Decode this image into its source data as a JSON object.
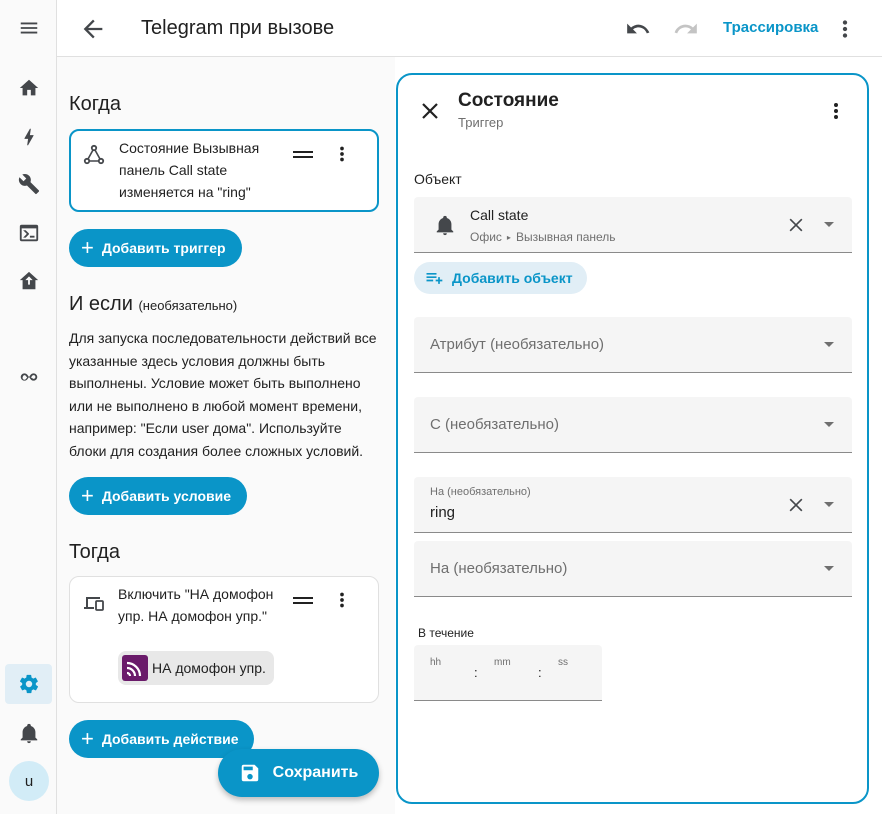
{
  "topbar": {
    "title": "Telegram при вызове",
    "trace_label": "Трассировка"
  },
  "sidebar": {
    "avatar_initial": "u",
    "items": [
      "home-icon",
      "lightning-icon",
      "wrench-icon",
      "terminal-icon",
      "ha-upload-icon",
      "integration-icon",
      "gear-icon",
      "bell-icon"
    ]
  },
  "when": {
    "heading": "Когда",
    "trigger_text": "Состояние Вызывная панель Call state изменяется на \"ring\"",
    "add_button": "Добавить триггер"
  },
  "and_if": {
    "heading": "И если",
    "heading_optional": "(необязательно)",
    "description": "Для запуска последовательности действий все указанные здесь условия должны быть выполнены. Условие может быть выполнено или не выполнено в любой момент времени, например: \"Если user дома\". Используйте блоки для создания более сложных условий.",
    "add_button": "Добавить условие"
  },
  "then": {
    "heading": "Тогда",
    "action_text": "Включить \"НА домофон упр. НА домофон упр.\"",
    "chip_label": "НА домофон упр.",
    "add_button": "Добавить действие"
  },
  "save_button": "Сохранить",
  "panel": {
    "title": "Состояние",
    "subtitle": "Триггер",
    "entity_label": "Объект",
    "entity_name": "Call state",
    "entity_area": "Офис",
    "entity_device": "Вызывная панель",
    "add_entity": "Добавить объект",
    "attribute_placeholder": "Атрибут (необязательно)",
    "from_placeholder": "С (необязательно)",
    "to_label": "На (необязательно)",
    "to_value": "ring",
    "to2_placeholder": "На (необязательно)",
    "duration_label": "В течение",
    "duration_units": {
      "hh": "hh",
      "mm": "mm",
      "ss": "ss"
    }
  },
  "colors": {
    "accent": "#0a95c8",
    "chip_icon": "#6a1b6a"
  }
}
